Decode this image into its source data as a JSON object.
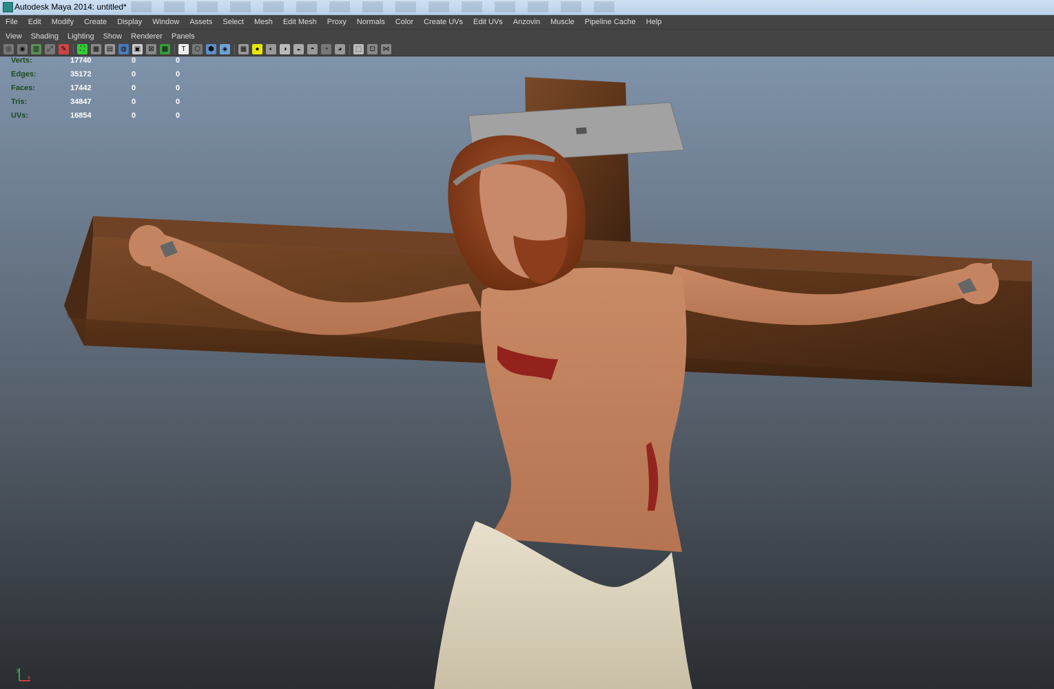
{
  "window": {
    "title": "Autodesk Maya 2014: untitled*"
  },
  "menu": [
    "File",
    "Edit",
    "Modify",
    "Create",
    "Display",
    "Window",
    "Assets",
    "Select",
    "Mesh",
    "Edit Mesh",
    "Proxy",
    "Normals",
    "Color",
    "Create UVs",
    "Edit UVs",
    "Anzovin",
    "Muscle",
    "Pipeline Cache",
    "Help"
  ],
  "panel_menu": [
    "View",
    "Shading",
    "Lighting",
    "Show",
    "Renderer",
    "Panels"
  ],
  "toolbar_icons": [
    "camera-attributes-icon",
    "bookmark-icon",
    "image-plane-icon",
    "2d-pan-zoom-icon",
    "grease-pencil-icon",
    "isolate-select-icon",
    "grid-icon",
    "film-gate-icon",
    "resolution-gate-icon",
    "gate-mask-icon",
    "field-chart-icon",
    "safe-action-icon",
    "safe-title-icon",
    "wireframe-icon",
    "smooth-shade-icon",
    "wireframe-on-shaded-icon",
    "textured-icon",
    "use-all-lights-icon",
    "shadows-icon",
    "screen-space-ao-icon",
    "motion-blur-icon",
    "anti-alias-icon",
    "depth-of-field-icon",
    "xray-icon",
    "xray-joints-icon",
    "backface-culling-icon",
    "smooth-wireframe-icon"
  ],
  "hud": {
    "rows": [
      {
        "label": "Verts:",
        "values": [
          "17740",
          "0",
          "0"
        ]
      },
      {
        "label": "Edges:",
        "values": [
          "35172",
          "0",
          "0"
        ]
      },
      {
        "label": "Faces:",
        "values": [
          "17442",
          "0",
          "0"
        ]
      },
      {
        "label": "Tris:",
        "values": [
          "34847",
          "0",
          "0"
        ]
      },
      {
        "label": "UVs:",
        "values": [
          "16854",
          "0",
          "0"
        ]
      }
    ]
  },
  "axis": {
    "x": "x",
    "y": "y"
  },
  "colors": {
    "menu_bg": "#444444",
    "hud_label": "#1c4b1c",
    "wood": "#6b3f22"
  }
}
